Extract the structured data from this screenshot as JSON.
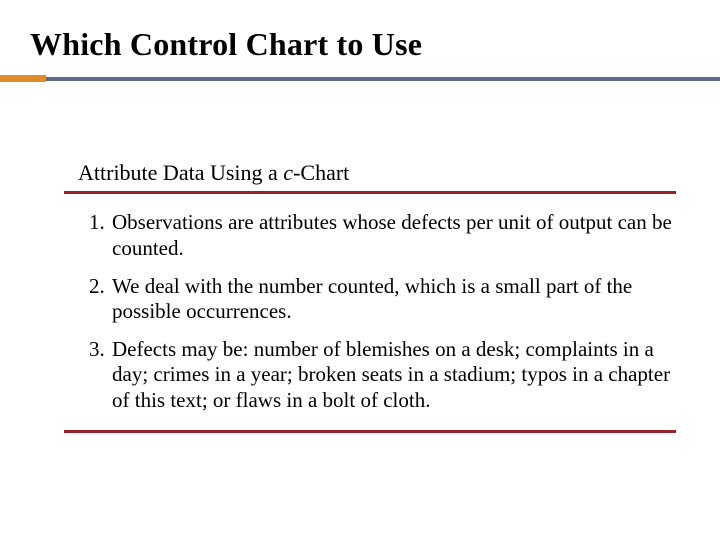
{
  "title": "Which Control Chart to Use",
  "subtitle_pre": "Attribute Data Using a ",
  "subtitle_it": "c",
  "subtitle_post": "-Chart",
  "items": [
    "Observations are attributes whose defects per unit of output can be counted.",
    "We deal with the number counted, which is a small part of the possible occurrences.",
    "Defects may be: number of blemishes on a desk; complaints in a day; crimes in a year; broken seats in a stadium; typos in a chapter of this text; or flaws in a bolt of cloth."
  ]
}
